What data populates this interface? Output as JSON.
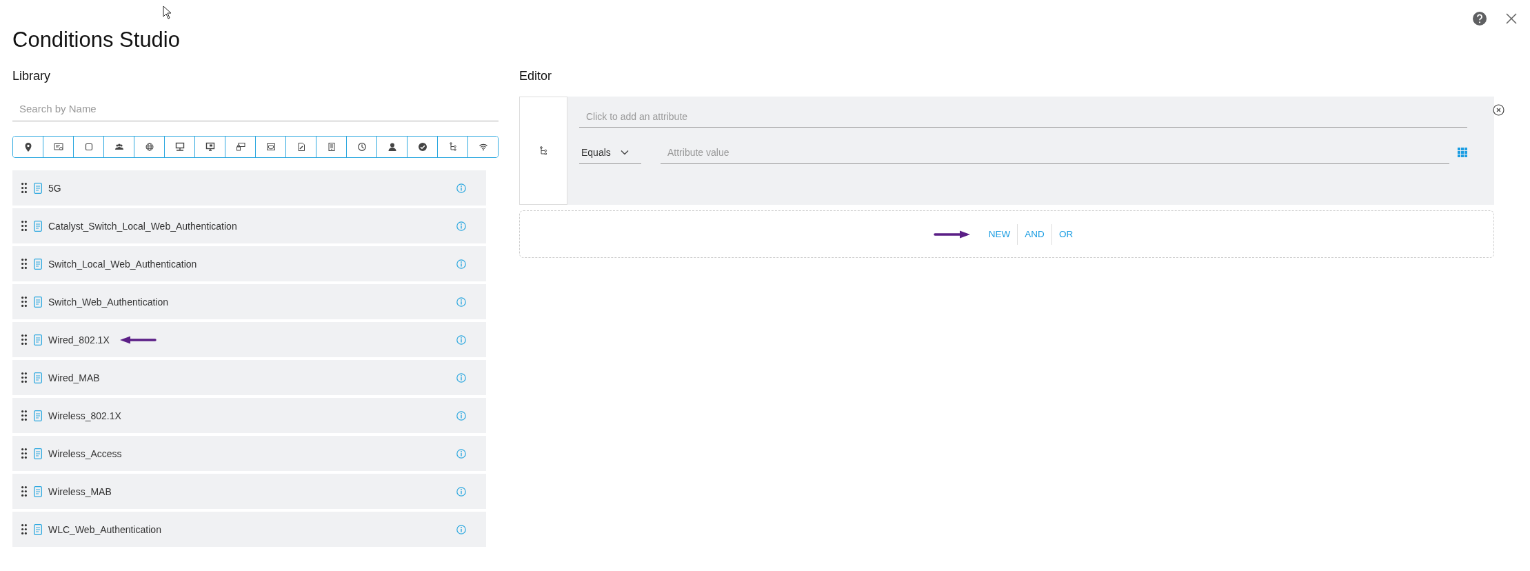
{
  "window": {
    "title": "Conditions Studio"
  },
  "library": {
    "heading": "Library",
    "search": {
      "placeholder": "Search by Name"
    },
    "items": [
      {
        "name": "5G",
        "marked": false
      },
      {
        "name": "Catalyst_Switch_Local_Web_Authentication",
        "marked": false
      },
      {
        "name": "Switch_Local_Web_Authentication",
        "marked": false
      },
      {
        "name": "Switch_Web_Authentication",
        "marked": false
      },
      {
        "name": "Wired_802.1X",
        "marked": true
      },
      {
        "name": "Wired_MAB",
        "marked": false
      },
      {
        "name": "Wireless_802.1X",
        "marked": false
      },
      {
        "name": "Wireless_Access",
        "marked": false
      },
      {
        "name": "Wireless_MAB",
        "marked": false
      },
      {
        "name": "WLC_Web_Authentication",
        "marked": false
      }
    ]
  },
  "editor": {
    "heading": "Editor",
    "attribute": {
      "placeholder": "Click to add an attribute"
    },
    "operator": "Equals",
    "value": {
      "placeholder": "Attribute value"
    },
    "actions": [
      {
        "label": "NEW",
        "marked": true
      },
      {
        "label": "AND",
        "marked": false
      },
      {
        "label": "OR",
        "marked": false
      }
    ]
  }
}
